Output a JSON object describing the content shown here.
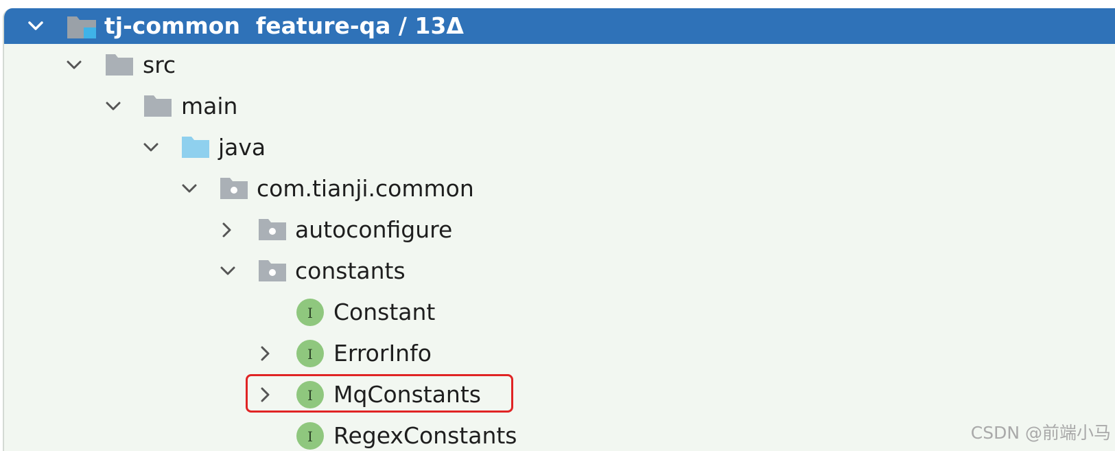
{
  "header": {
    "title": "tj-common  feature-qa / 13Δ",
    "icon": "module-folder-icon"
  },
  "tree": [
    {
      "label": "src",
      "expanded": true,
      "folder_color": "#aab0b6"
    },
    {
      "label": "main",
      "expanded": true,
      "folder_color": "#aab0b6"
    },
    {
      "label": "java",
      "expanded": true,
      "folder_color": "#8fd0ee"
    },
    {
      "label": "com.tianji.common",
      "expanded": true,
      "folder_color": "#aab0b6"
    },
    {
      "label": "autoconfigure",
      "expanded": false,
      "folder_color": "#aab0b6"
    },
    {
      "label": "constants",
      "expanded": true,
      "folder_color": "#aab0b6"
    },
    {
      "label": "Constant",
      "kind": "interface"
    },
    {
      "label": "ErrorInfo",
      "kind": "interface",
      "expandable": true
    },
    {
      "label": "MqConstants",
      "kind": "interface",
      "expandable": true,
      "highlighted": true
    },
    {
      "label": "RegexConstants",
      "kind": "interface"
    }
  ],
  "interface_icon_letter": "I",
  "colors": {
    "header_bg": "#2f72b8",
    "panel_bg": "#f2f7f1",
    "interface_icon": "#8fc77e",
    "highlight_border": "#e02424"
  },
  "watermark": "CSDN @前端小马"
}
